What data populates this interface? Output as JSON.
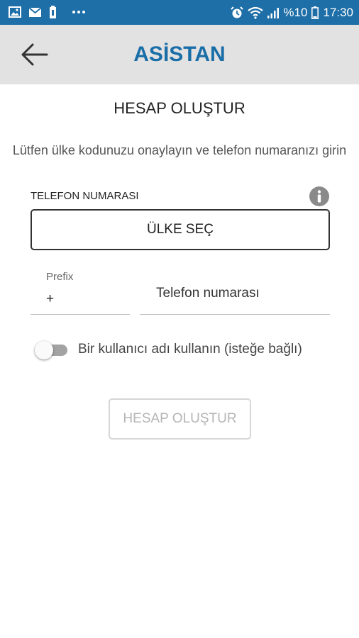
{
  "status_bar": {
    "battery_text": "%10",
    "time": "17:30",
    "left_icons": [
      "image-icon",
      "mail-icon",
      "battery-saver-icon",
      "more-icon"
    ],
    "right_icons": [
      "alarm-icon",
      "wifi-icon",
      "signal-icon",
      "battery-icon"
    ]
  },
  "app_bar": {
    "title": "ASİSTAN",
    "back_icon": "arrow-left-icon"
  },
  "page": {
    "title": "HESAP OLUŞTUR",
    "instruction": "Lütfen ülke kodunuzu onaylayın ve telefon numaranızı girin"
  },
  "phone_section": {
    "label": "TELEFON NUMARASI",
    "info_icon": "info-icon",
    "country_button": "ÜLKE SEÇ",
    "prefix_label": "Prefix",
    "prefix_value": "+",
    "phone_placeholder": "Telefon numarası"
  },
  "username_toggle": {
    "label": "Bir kullanıcı adı kullanın (isteğe bağlı)",
    "enabled": false
  },
  "submit": {
    "label": "HESAP OLUŞTUR",
    "enabled": false
  },
  "colors": {
    "status_bar": "#1e6ea7",
    "app_bar": "#e2e2e2",
    "title_accent": "#1a6ea8",
    "disabled_text": "#b5b5b5"
  }
}
